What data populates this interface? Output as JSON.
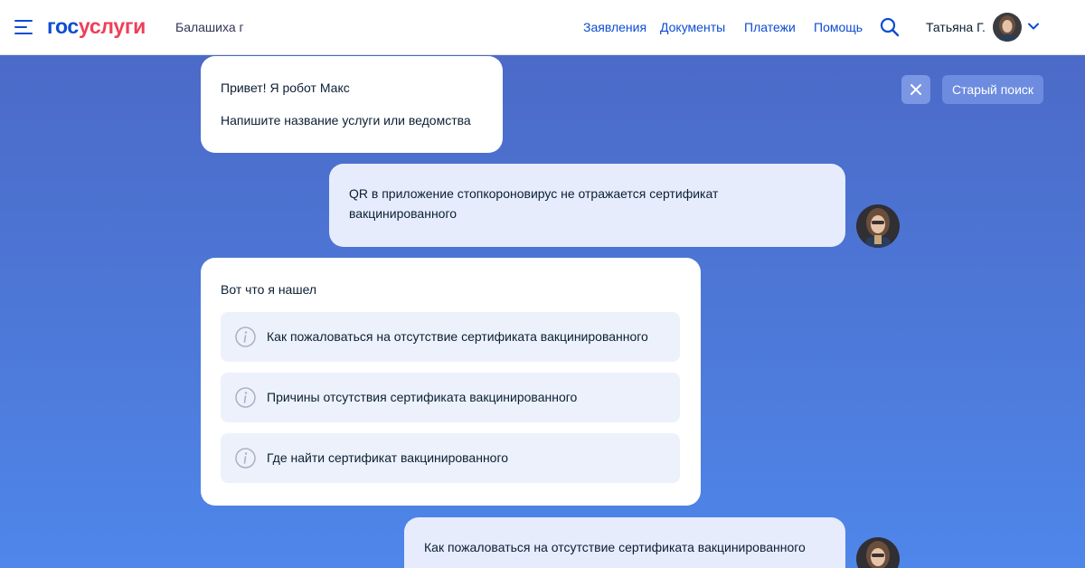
{
  "header": {
    "logo_part1": "гос",
    "logo_part2": "услуги",
    "city": "Балашиха г",
    "nav": [
      "Заявления",
      "Документы",
      "Платежи",
      "Помощь"
    ],
    "user_name": "Татьяна Г."
  },
  "controls": {
    "close_icon": "close-icon",
    "old_search_label": "Старый поиск"
  },
  "chat": {
    "bot_greeting": [
      "Привет! Я робот Макс",
      "Напишите название услуги или ведомства"
    ],
    "user_message_1": "QR в приложение стопкороновирус не отражается сертификат вакцинированного",
    "bot_results_title": "Вот что я нашел",
    "options": [
      "Как пожаловаться на отсутствие сертификата вакцинированного",
      "Причины отсутствия сертификата вакцинированного",
      "Где найти сертификат вакцинированного"
    ],
    "user_message_2": "Как пожаловаться на отсутствие сертификата вакцинированного"
  },
  "colors": {
    "brand_blue": "#0d4cd3",
    "brand_red": "#ee3f58",
    "background_gradient_top": "#4c6ac8",
    "background_gradient_bottom": "#4f86ea",
    "user_bubble": "#e6ecfc",
    "option_bg": "#ecf1fc"
  }
}
